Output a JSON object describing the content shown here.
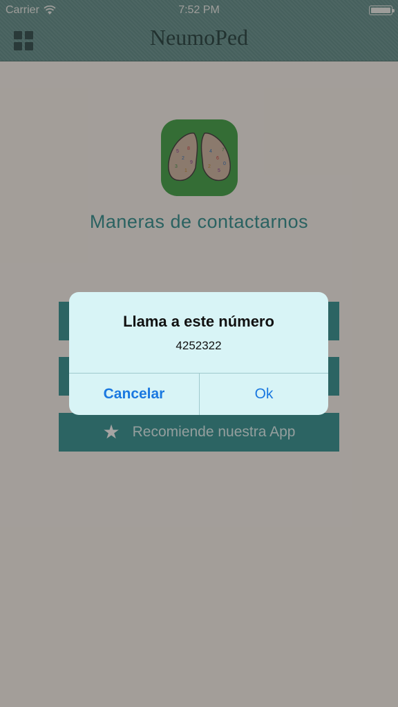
{
  "status_bar": {
    "carrier": "Carrier",
    "time": "7:52 PM"
  },
  "navbar": {
    "title": "NeumoPed",
    "menu_icon": "grid-menu-icon"
  },
  "content": {
    "section_title": "Maneras de contactarnos",
    "buttons": [
      {
        "label": ""
      },
      {
        "label": ""
      },
      {
        "label": "Recomiende nuestra App",
        "icon": "star-icon"
      }
    ]
  },
  "alert": {
    "title": "Llama a este número",
    "message": "4252322",
    "cancel_label": "Cancelar",
    "ok_label": "Ok"
  },
  "colors": {
    "navbar": "#5d8e8a",
    "accent": "#2f9090",
    "alert_button": "#1a78e0",
    "app_icon_bg": "#3d9e46"
  }
}
